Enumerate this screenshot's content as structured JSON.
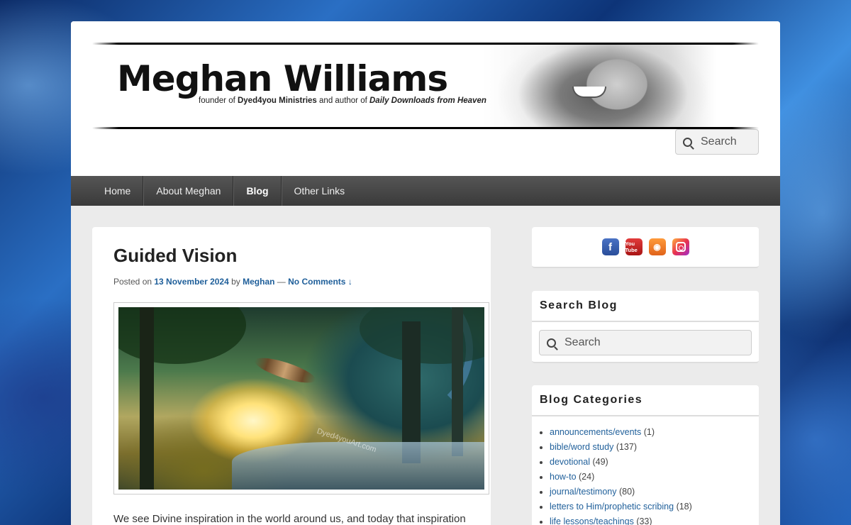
{
  "header": {
    "name": "Meghan Williams",
    "tagline_pre": "founder of ",
    "tagline_ministry": "Dyed4you Ministries",
    "tagline_mid": " and author of ",
    "tagline_book": "Daily Downloads from Heaven",
    "search_placeholder": "Search"
  },
  "nav": {
    "items": [
      {
        "label": "Home"
      },
      {
        "label": "About Meghan"
      },
      {
        "label": "Blog"
      },
      {
        "label": "Other Links"
      }
    ],
    "active": "Blog"
  },
  "post": {
    "title": "Guided Vision",
    "meta_posted": "Posted on ",
    "date": "13 November 2024",
    "meta_by": " by ",
    "author": "Meghan",
    "meta_sep": " — ",
    "comments": "No Comments ↓",
    "image_watermark": "Dyed4youArt.com",
    "excerpt": "We see Divine inspiration in the world around us, and today that inspiration"
  },
  "sidebar": {
    "social": {
      "icons": [
        "facebook-icon",
        "youtube-icon",
        "rss-icon",
        "instagram-icon"
      ],
      "fb_glyph": "f",
      "yt_glyph": "You Tube",
      "rss_glyph": "◉"
    },
    "search": {
      "title": "Search Blog",
      "placeholder": "Search"
    },
    "categories": {
      "title": "Blog Categories",
      "items": [
        {
          "label": "announcements/events",
          "count": "(1)"
        },
        {
          "label": "bible/word study",
          "count": "(137)"
        },
        {
          "label": "devotional",
          "count": "(49)"
        },
        {
          "label": "how-to",
          "count": "(24)"
        },
        {
          "label": "journal/testimony",
          "count": "(80)"
        },
        {
          "label": "letters to Him/prophetic scribing",
          "count": "(18)"
        },
        {
          "label": "life lessons/teachings",
          "count": "(33)"
        }
      ]
    }
  },
  "colors": {
    "link": "#1f5f9a",
    "nav_bg": "#444444",
    "page_bg": "#ebebeb"
  }
}
